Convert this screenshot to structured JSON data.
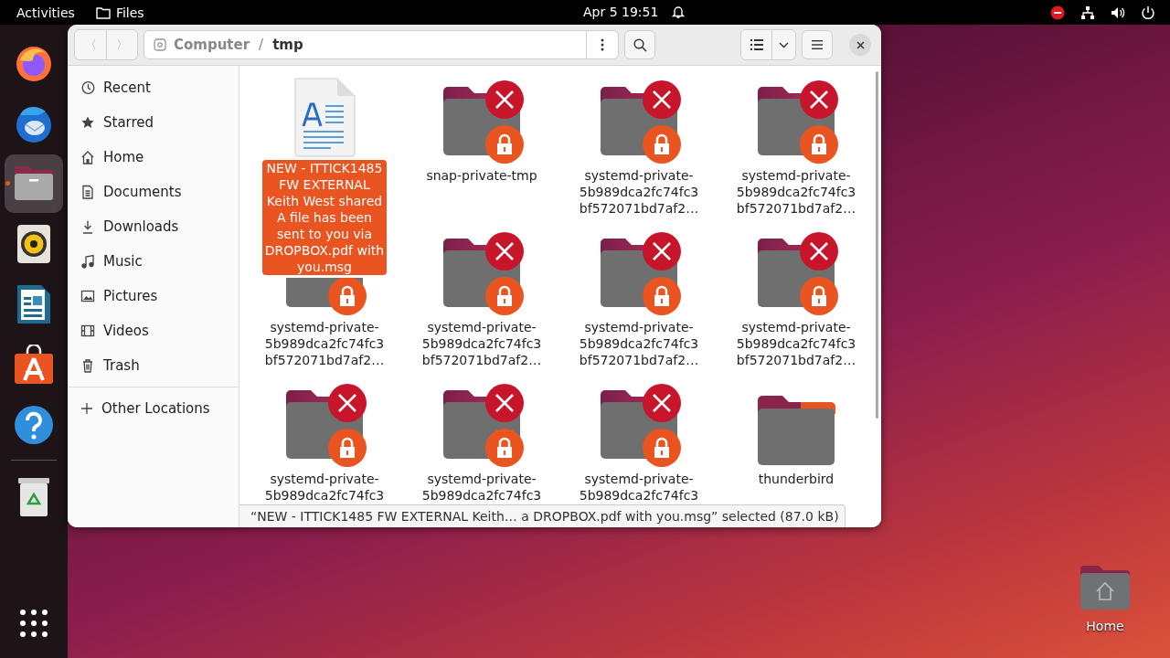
{
  "top_bar": {
    "activities": "Activities",
    "app_name": "Files",
    "clock": "Apr 5  19:51"
  },
  "dock": {
    "apps": [
      {
        "kind": "browser",
        "running": false
      },
      {
        "kind": "mail",
        "running": false
      },
      {
        "kind": "files",
        "running": true
      },
      {
        "kind": "music",
        "running": false
      },
      {
        "kind": "writer",
        "running": false
      },
      {
        "kind": "store",
        "running": false
      },
      {
        "kind": "help",
        "running": false
      }
    ],
    "trash": {
      "kind": "trash"
    }
  },
  "window": {
    "nav": [
      {
        "label": "〈",
        "disabled": true
      },
      {
        "label": "〉",
        "disabled": true
      }
    ],
    "path": [
      "Computer",
      "tmp"
    ],
    "path_separator": "/"
  },
  "sidebar": {
    "items": [
      {
        "kind": "recent",
        "label": "Recent",
        "selected": false
      },
      {
        "kind": "starred",
        "label": "Starred",
        "selected": false
      },
      {
        "kind": "home",
        "label": "Home",
        "selected": false
      },
      {
        "kind": "documents",
        "label": "Documents",
        "selected": false
      },
      {
        "kind": "downloads",
        "label": "Downloads",
        "selected": false
      },
      {
        "kind": "music",
        "label": "Music",
        "selected": false
      },
      {
        "kind": "pictures",
        "label": "Pictures",
        "selected": false
      },
      {
        "kind": "videos",
        "label": "Videos",
        "selected": false
      },
      {
        "kind": "trash",
        "label": "Trash",
        "selected": false
      }
    ],
    "other": {
      "kind": "plus",
      "label": "Other Locations"
    }
  },
  "files": [
    {
      "kind": "document",
      "selected": true,
      "name_lines": [
        "NEW - ITTICK1485",
        "FW EXTERNAL",
        "Keith West shared",
        "A file has been",
        "sent to you via",
        "DROPBOX.pdf with",
        "you.msg"
      ]
    },
    {
      "kind": "locked-folder",
      "selected": false,
      "name_lines": [
        "snap-private-tmp"
      ]
    },
    {
      "kind": "locked-folder",
      "selected": false,
      "name_lines": [
        "systemd-private-",
        "5b989dca2fc74fc3",
        "bf572071bd7af2…"
      ]
    },
    {
      "kind": "locked-folder",
      "selected": false,
      "name_lines": [
        "systemd-private-",
        "5b989dca2fc74fc3",
        "bf572071bd7af2…"
      ]
    },
    {
      "kind": "locked-folder",
      "selected": false,
      "name_lines": [
        "systemd-private-",
        "5b989dca2fc74fc3",
        "bf572071bd7af2…"
      ]
    },
    {
      "kind": "locked-folder",
      "selected": false,
      "name_lines": [
        "systemd-private-",
        "5b989dca2fc74fc3",
        "bf572071bd7af2…"
      ]
    },
    {
      "kind": "locked-folder",
      "selected": false,
      "name_lines": [
        "systemd-private-",
        "5b989dca2fc74fc3",
        "bf572071bd7af2…"
      ]
    },
    {
      "kind": "locked-folder",
      "selected": false,
      "name_lines": [
        "systemd-private-",
        "5b989dca2fc74fc3",
        "bf572071bd7af2…"
      ]
    },
    {
      "kind": "locked-folder",
      "selected": false,
      "name_lines": [
        "systemd-private-",
        "5b989dca2fc74fc3"
      ]
    },
    {
      "kind": "locked-folder",
      "selected": false,
      "name_lines": [
        "systemd-private-",
        "5b989dca2fc74fc3"
      ]
    },
    {
      "kind": "locked-folder",
      "selected": false,
      "name_lines": [
        "systemd-private-",
        "5b989dca2fc74fc3"
      ]
    },
    {
      "kind": "folder",
      "selected": false,
      "name_lines": [
        "thunderbird"
      ]
    }
  ],
  "status_bar": "“NEW - ITTICK1485 FW EXTERNAL Keith… a DROPBOX.pdf with you.msg” selected (87.0 kB)",
  "desktop_icons": [
    {
      "kind": "home",
      "label": "Home"
    }
  ]
}
